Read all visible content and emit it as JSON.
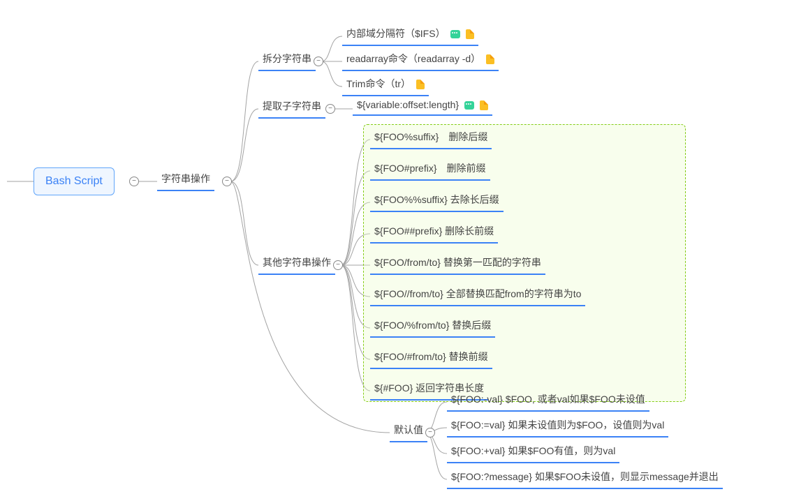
{
  "root": {
    "label": "Bash Script"
  },
  "branch1": {
    "label": "字符串操作"
  },
  "b1_1": {
    "label": "拆分字符串",
    "children": [
      {
        "label": "内部域分隔符（$IFS）",
        "comment": true,
        "note": true
      },
      {
        "label": "readarray命令（readarray -d）",
        "comment": false,
        "note": true
      },
      {
        "label": "Trim命令（tr）",
        "comment": false,
        "note": true
      }
    ]
  },
  "b1_2": {
    "label": "提取子字符串",
    "children": [
      {
        "label": "${variable:offset:length}",
        "comment": true,
        "note": true
      }
    ]
  },
  "b1_3": {
    "label": "其他字符串操作",
    "children": [
      {
        "label": "${FOO%suffix}　删除后缀"
      },
      {
        "label": "${FOO#prefix}　删除前缀"
      },
      {
        "label": "${FOO%%suffix}  去除长后缀"
      },
      {
        "label": "${FOO##prefix}  删除长前缀"
      },
      {
        "label": "${FOO/from/to}  替换第一匹配的字符串"
      },
      {
        "label": "${FOO//from/to} 全部替换匹配from的字符串为to"
      },
      {
        "label": "${FOO/%from/to} 替换后缀"
      },
      {
        "label": "${FOO/#from/to} 替换前缀"
      },
      {
        "label": "${#FOO} 返回字符串长度"
      }
    ]
  },
  "b1_4": {
    "label": "默认值",
    "children": [
      {
        "label": "${FOO:-val} $FOO, 或者val如果$FOO未设值"
      },
      {
        "label": "${FOO:=val} 如果未设值则为$FOO，设值则为val"
      },
      {
        "label": "${FOO:+val} 如果$FOO有值，则为val"
      },
      {
        "label": "${FOO:?message} 如果$FOO未设值，则显示message并退出"
      }
    ]
  },
  "collapse_symbol": "−"
}
